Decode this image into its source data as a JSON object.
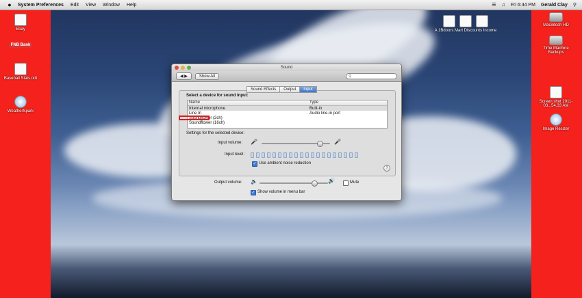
{
  "menubar": {
    "app_name": "System Preferences",
    "items": [
      "Edit",
      "View",
      "Window",
      "Help"
    ],
    "clock": "Fri 6:44 PM",
    "user": "Gerald Clay"
  },
  "desktop_left": [
    {
      "label": "Ebay",
      "icon": "document-icon"
    },
    {
      "label": "FNB Bank",
      "icon": "document-icon"
    },
    {
      "label": "Baseball Stats.odt",
      "icon": "document-icon"
    },
    {
      "label": "WeatherSpark",
      "icon": "document-icon"
    }
  ],
  "desktop_top": {
    "label": "A 1Bdoors.Mart Discounts Income"
  },
  "desktop_right": [
    {
      "label": "Macintosh HD",
      "icon": "drive-icon"
    },
    {
      "label": "Time Machine Backups",
      "icon": "drive-icon"
    },
    {
      "label": "Screen shot 2011-03...54.33 AM",
      "icon": "document-icon"
    },
    {
      "label": "Image Resizer",
      "icon": "app-icon"
    }
  ],
  "window": {
    "title": "Sound",
    "show_all": "Show All",
    "tabs": [
      "Sound Effects",
      "Output",
      "Input"
    ],
    "selected_tab": "Input",
    "select_heading": "Select a device for sound input:",
    "columns": [
      "Name",
      "Type"
    ],
    "devices": [
      {
        "name": "Internal microphone",
        "type": "Built-in"
      },
      {
        "name": "Line In",
        "type": "Audio line-in port"
      },
      {
        "name": "Soundflower (2ch)",
        "type": ""
      },
      {
        "name": "Soundflower (16ch)",
        "type": ""
      }
    ],
    "settings_heading": "Settings for the selected device:",
    "input_volume_label": "Input volume:",
    "input_volume": 0.85,
    "input_level_label": "Input level:",
    "ambient_noise_label": "Use ambient noise reduction",
    "ambient_noise_checked": true,
    "output_volume_label": "Output volume:",
    "output_volume": 0.8,
    "mute_label": "Mute",
    "mute_checked": false,
    "show_volume_label": "Show volume in menu bar",
    "show_volume_checked": true,
    "help": "?"
  }
}
